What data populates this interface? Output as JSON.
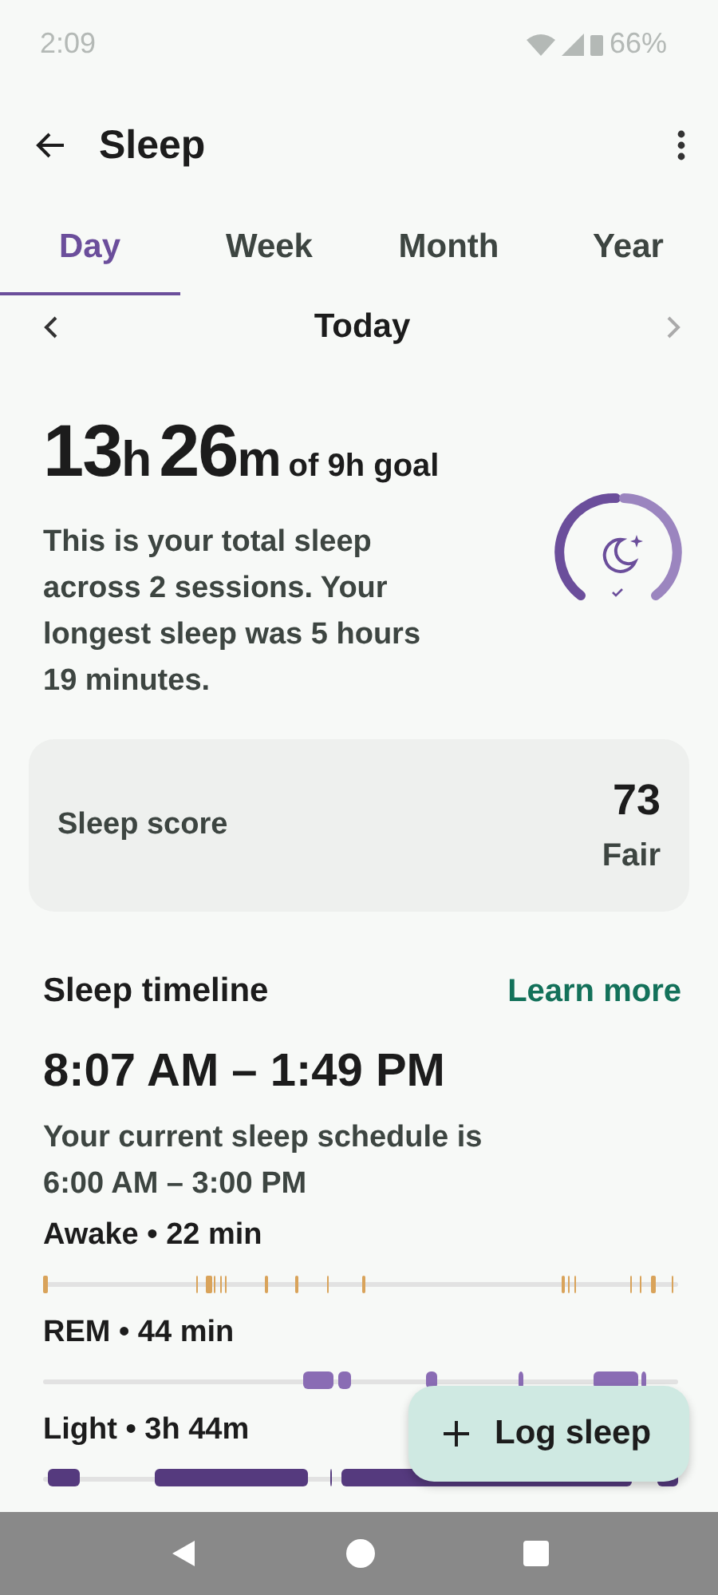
{
  "status_bar": {
    "time": "2:09",
    "battery": "66%"
  },
  "toolbar": {
    "title": "Sleep"
  },
  "tabs": [
    {
      "label": "Day",
      "selected": true
    },
    {
      "label": "Week",
      "selected": false
    },
    {
      "label": "Month",
      "selected": false
    },
    {
      "label": "Year",
      "selected": false
    }
  ],
  "date_nav": {
    "label": "Today",
    "next_disabled": true
  },
  "summary": {
    "duration": [
      {
        "value": "13",
        "unit": "h"
      },
      {
        "value": "26",
        "unit": "m"
      }
    ],
    "goal": "of 9h goal",
    "description": "This is your total sleep across 2 sessions. Your longest sleep was 5 hours 19 minutes."
  },
  "score_card": {
    "label": "Sleep score",
    "score": "73",
    "rating": "Fair"
  },
  "timeline": {
    "title": "Sleep timeline",
    "link": "Learn more",
    "range": "8:07 AM – 1:49 PM",
    "schedule": "Your current sleep schedule is 6:00 AM – 3:00 PM",
    "stages": [
      {
        "label": "Awake • 22 min",
        "color": "#d9a35a",
        "kind": "ticks"
      },
      {
        "label": "REM • 44 min",
        "color": "#8a6cb4",
        "kind": "blocks"
      },
      {
        "label": "Light • 3h 44m",
        "color": "#553a7e",
        "kind": "blocks"
      }
    ]
  },
  "fab": {
    "label": "Log sleep"
  }
}
